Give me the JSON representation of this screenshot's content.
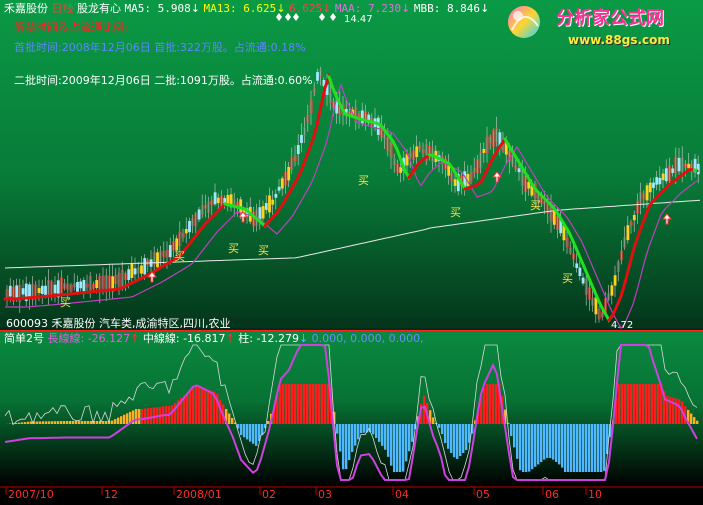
{
  "header": {
    "stock_name": "禾嘉股份",
    "period": "日线",
    "indicator_name": "股龙有心",
    "ma5": "MA5: 5.908",
    "ma13": "MA13: 6.625",
    "extra_val": "6.625",
    "maa": "MAA: 7.230",
    "mbb": "MBB: 8.846",
    "arrow": "↓"
  },
  "watermark": {
    "brand": "分析家公式网",
    "url": "www.88gs.com"
  },
  "notes": {
    "red_line": "解禁时间及占流通比例:",
    "first_batch": "首批时间:2008年12月06日  首批:322万股。占流通:0.18%",
    "second_batch": "二批时间:2009年12月06日  二批:1091万股。占流通:0.60%"
  },
  "price_labels": {
    "high": "14.47",
    "low": "4.72"
  },
  "buy_labels": [
    "买",
    "买",
    "买",
    "买",
    "买",
    "买",
    "买",
    "买"
  ],
  "info_bar": "600093  禾嘉股份  汽车类,成渝特区,四川,农业",
  "sub_header": {
    "name": "简单2号",
    "long_line": "長線線: -26.127",
    "mid_line": "中線線: -16.817",
    "bar": "柱: -12.279",
    "zeros": "0.000, 0.000, 0.000,",
    "up": "↑",
    "down": "↓"
  },
  "date_axis": [
    "2007/10",
    "12",
    "2008/01",
    "02",
    "03",
    "04",
    "05",
    "06",
    "10"
  ],
  "colors": {
    "green_bg": "#0b7a37",
    "red_line": "#e01010",
    "green_line": "#20e020",
    "purple_line": "#c040c0",
    "white_line": "#e8e8e8",
    "cyan_bar": "#4fb8ff",
    "text_red": "#ff3030",
    "text_blue": "#6f8cff"
  }
}
